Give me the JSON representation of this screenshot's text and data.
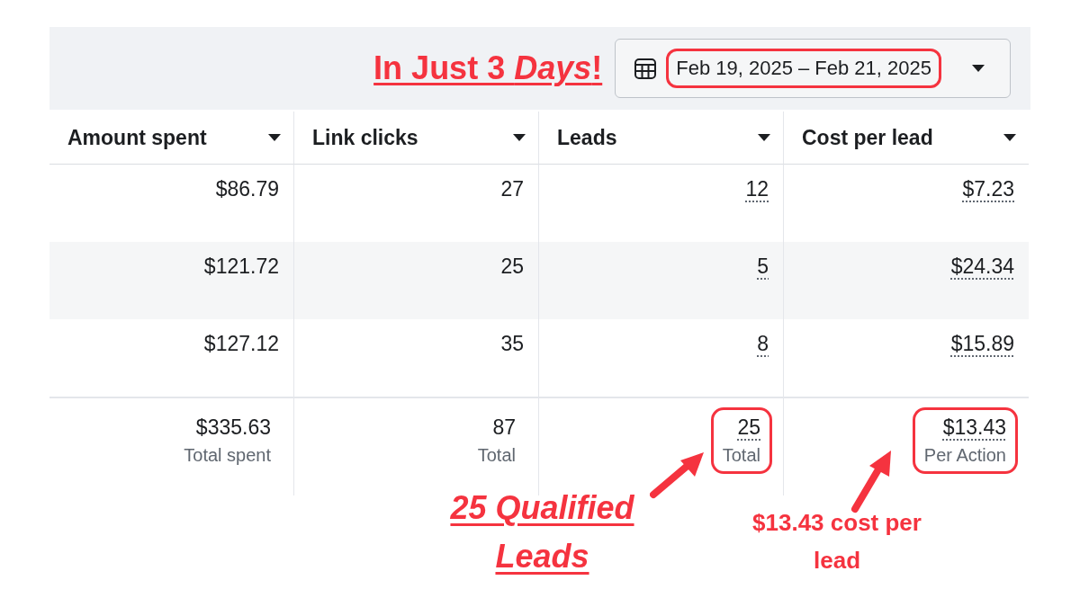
{
  "header": {
    "headline": "In Just 3 *Days*!",
    "date_range": "Feb 19, 2025 – Feb 21, 2025",
    "date_highlighted": true
  },
  "table": {
    "columns": [
      {
        "label": "Amount spent",
        "underlined": false
      },
      {
        "label": "Link clicks",
        "underlined": false
      },
      {
        "label": "Leads",
        "underlined": true
      },
      {
        "label": "Cost per lead",
        "underlined": true
      }
    ],
    "rows": [
      {
        "cells": [
          "$86.79",
          "27",
          "12",
          "$7.23"
        ]
      },
      {
        "cells": [
          "$121.72",
          "25",
          "5",
          "$24.34"
        ]
      },
      {
        "cells": [
          "$127.12",
          "35",
          "8",
          "$15.89"
        ]
      }
    ],
    "totals": [
      {
        "value": "$335.63",
        "label": "Total spent",
        "highlighted": false
      },
      {
        "value": "87",
        "label": "Total",
        "highlighted": false
      },
      {
        "value": "25",
        "label": "Total",
        "highlighted": true
      },
      {
        "value": "$13.43",
        "label": "Per Action",
        "highlighted": true
      }
    ]
  },
  "annotations": [
    {
      "kind": "large",
      "text": "25 Qualified Leads"
    },
    {
      "kind": "small",
      "text": "$13.43 cost per lead"
    }
  ]
}
